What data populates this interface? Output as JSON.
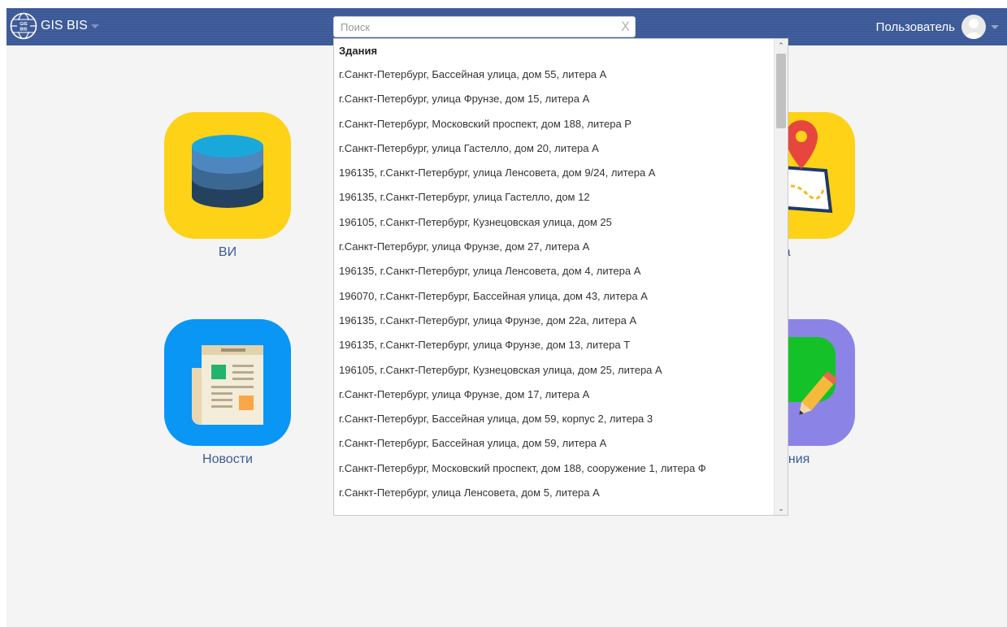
{
  "navbar": {
    "brand_name": "GIS BIS",
    "logo_text": "GIS BIS",
    "search": {
      "placeholder": "Поиск",
      "value": "",
      "clear_symbol": "X"
    },
    "user_name": "Пользователь"
  },
  "tiles": [
    {
      "label": "ВИ",
      "icon": "database-icon",
      "color": "#fdd217"
    },
    {
      "label": "рта",
      "icon": "map-pin-icon",
      "color": "#fdd217"
    },
    {
      "label": "Новости",
      "icon": "newspaper-icon",
      "color": "#0a96f5"
    },
    {
      "label": "щения",
      "icon": "messages-icon",
      "color": "#8b84e6"
    }
  ],
  "dropdown": {
    "group_label": "Здания",
    "items": [
      "г.Санкт-Петербург, Бассейная улица, дом 55, литера А",
      "г.Санкт-Петербург, улица Фрунзе, дом 15, литера А",
      "г.Санкт-Петербург, Московский проспект, дом 188, литера Р",
      "г.Санкт-Петербург, улица Гастелло, дом 20, литера А",
      "196135, г.Санкт-Петербург, улица Ленсовета, дом 9/24, литера А",
      "196135, г.Санкт-Петербург, улица Гастелло, дом 12",
      "196105, г.Санкт-Петербург, Кузнецовская улица, дом 25",
      "г.Санкт-Петербург, улица Фрунзе, дом 27, литера А",
      "196135, г.Санкт-Петербург, улица Ленсовета, дом 4, литера А",
      "196070, г.Санкт-Петербург, Бассейная улица, дом 43, литера А",
      "196135, г.Санкт-Петербург, улица Фрунзе, дом 22а, литера А",
      "196135, г.Санкт-Петербург, улица Фрунзе, дом 13, литера Т",
      "196105, г.Санкт-Петербург, Кузнецовская улица, дом 25, литера А",
      "г.Санкт-Петербург, улица Фрунзе, дом 17, литера А",
      "г.Санкт-Петербург, Бассейная улица, дом 59, корпус 2, литера 3",
      "г.Санкт-Петербург, Бассейная улица, дом 59, литера А",
      "г.Санкт-Петербург, Московский проспект, дом 188, сооружение 1, литера Ф",
      "г.Санкт-Петербург, улица Ленсовета, дом 5, литера А"
    ],
    "scroll_up_symbol": "⌃",
    "scroll_down_symbol": "⌄"
  },
  "colors": {
    "navbar": "#3b5998",
    "tile_label": "#3c5a94",
    "background": "#f4f4f4"
  }
}
